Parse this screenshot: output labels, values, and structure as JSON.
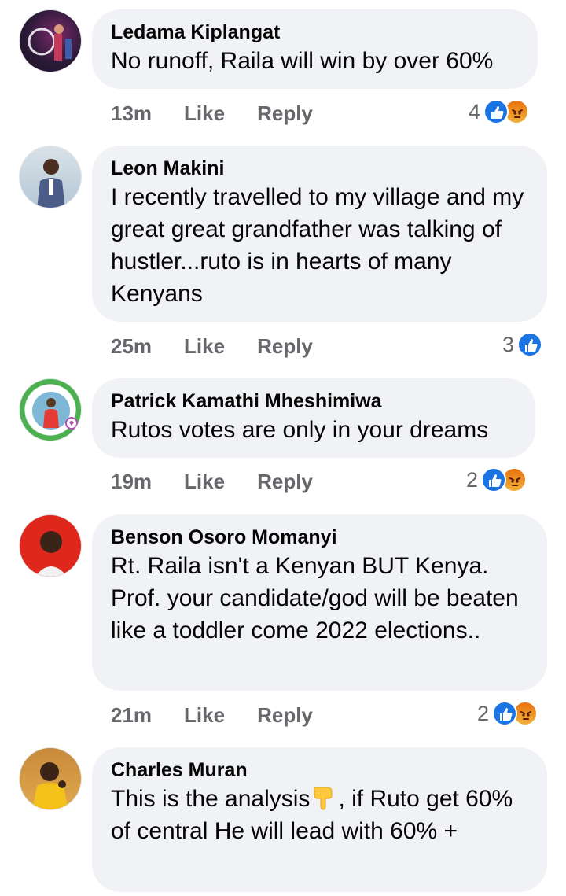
{
  "comments": [
    {
      "author": "Ledama Kiplangat",
      "text": "No runoff, Raila will win by over 60%",
      "time": "13m",
      "like_label": "Like",
      "reply_label": "Reply",
      "reaction_count": "4",
      "reactions": [
        "like-icon",
        "angry-icon"
      ]
    },
    {
      "author": "Leon Makini",
      "text": "I recently travelled to my village and my great great grandfather was talking of hustler...ruto is in hearts of many Kenyans",
      "time": "25m",
      "like_label": "Like",
      "reply_label": "Reply",
      "reaction_count": "3",
      "reactions": [
        "like-icon"
      ]
    },
    {
      "author": "Patrick Kamathi Mheshimiwa",
      "text": "Rutos votes are only in your dreams",
      "time": "19m",
      "like_label": "Like",
      "reply_label": "Reply",
      "reaction_count": "2",
      "reactions": [
        "like-icon",
        "angry-icon"
      ]
    },
    {
      "author": "Benson Osoro Momanyi",
      "text": "Rt. Raila isn't a Kenyan BUT Kenya. Prof. your candidate/god will be beaten like a toddler come 2022 elections..",
      "time": "21m",
      "like_label": "Like",
      "reply_label": "Reply",
      "reaction_count": "2",
      "reactions": [
        "like-icon",
        "angry-icon"
      ]
    },
    {
      "author": "Charles Muran",
      "text_before": "This is the analysis",
      "text_emoji": "pointing-down-hand-emoji",
      "text_after": ", if Ruto get 60% of central He will lead with 60% +"
    }
  ],
  "colors": {
    "bubble": "#f0f2f5",
    "meta": "#65676b",
    "like": "#1b74e4",
    "angry": "#e9710f"
  }
}
